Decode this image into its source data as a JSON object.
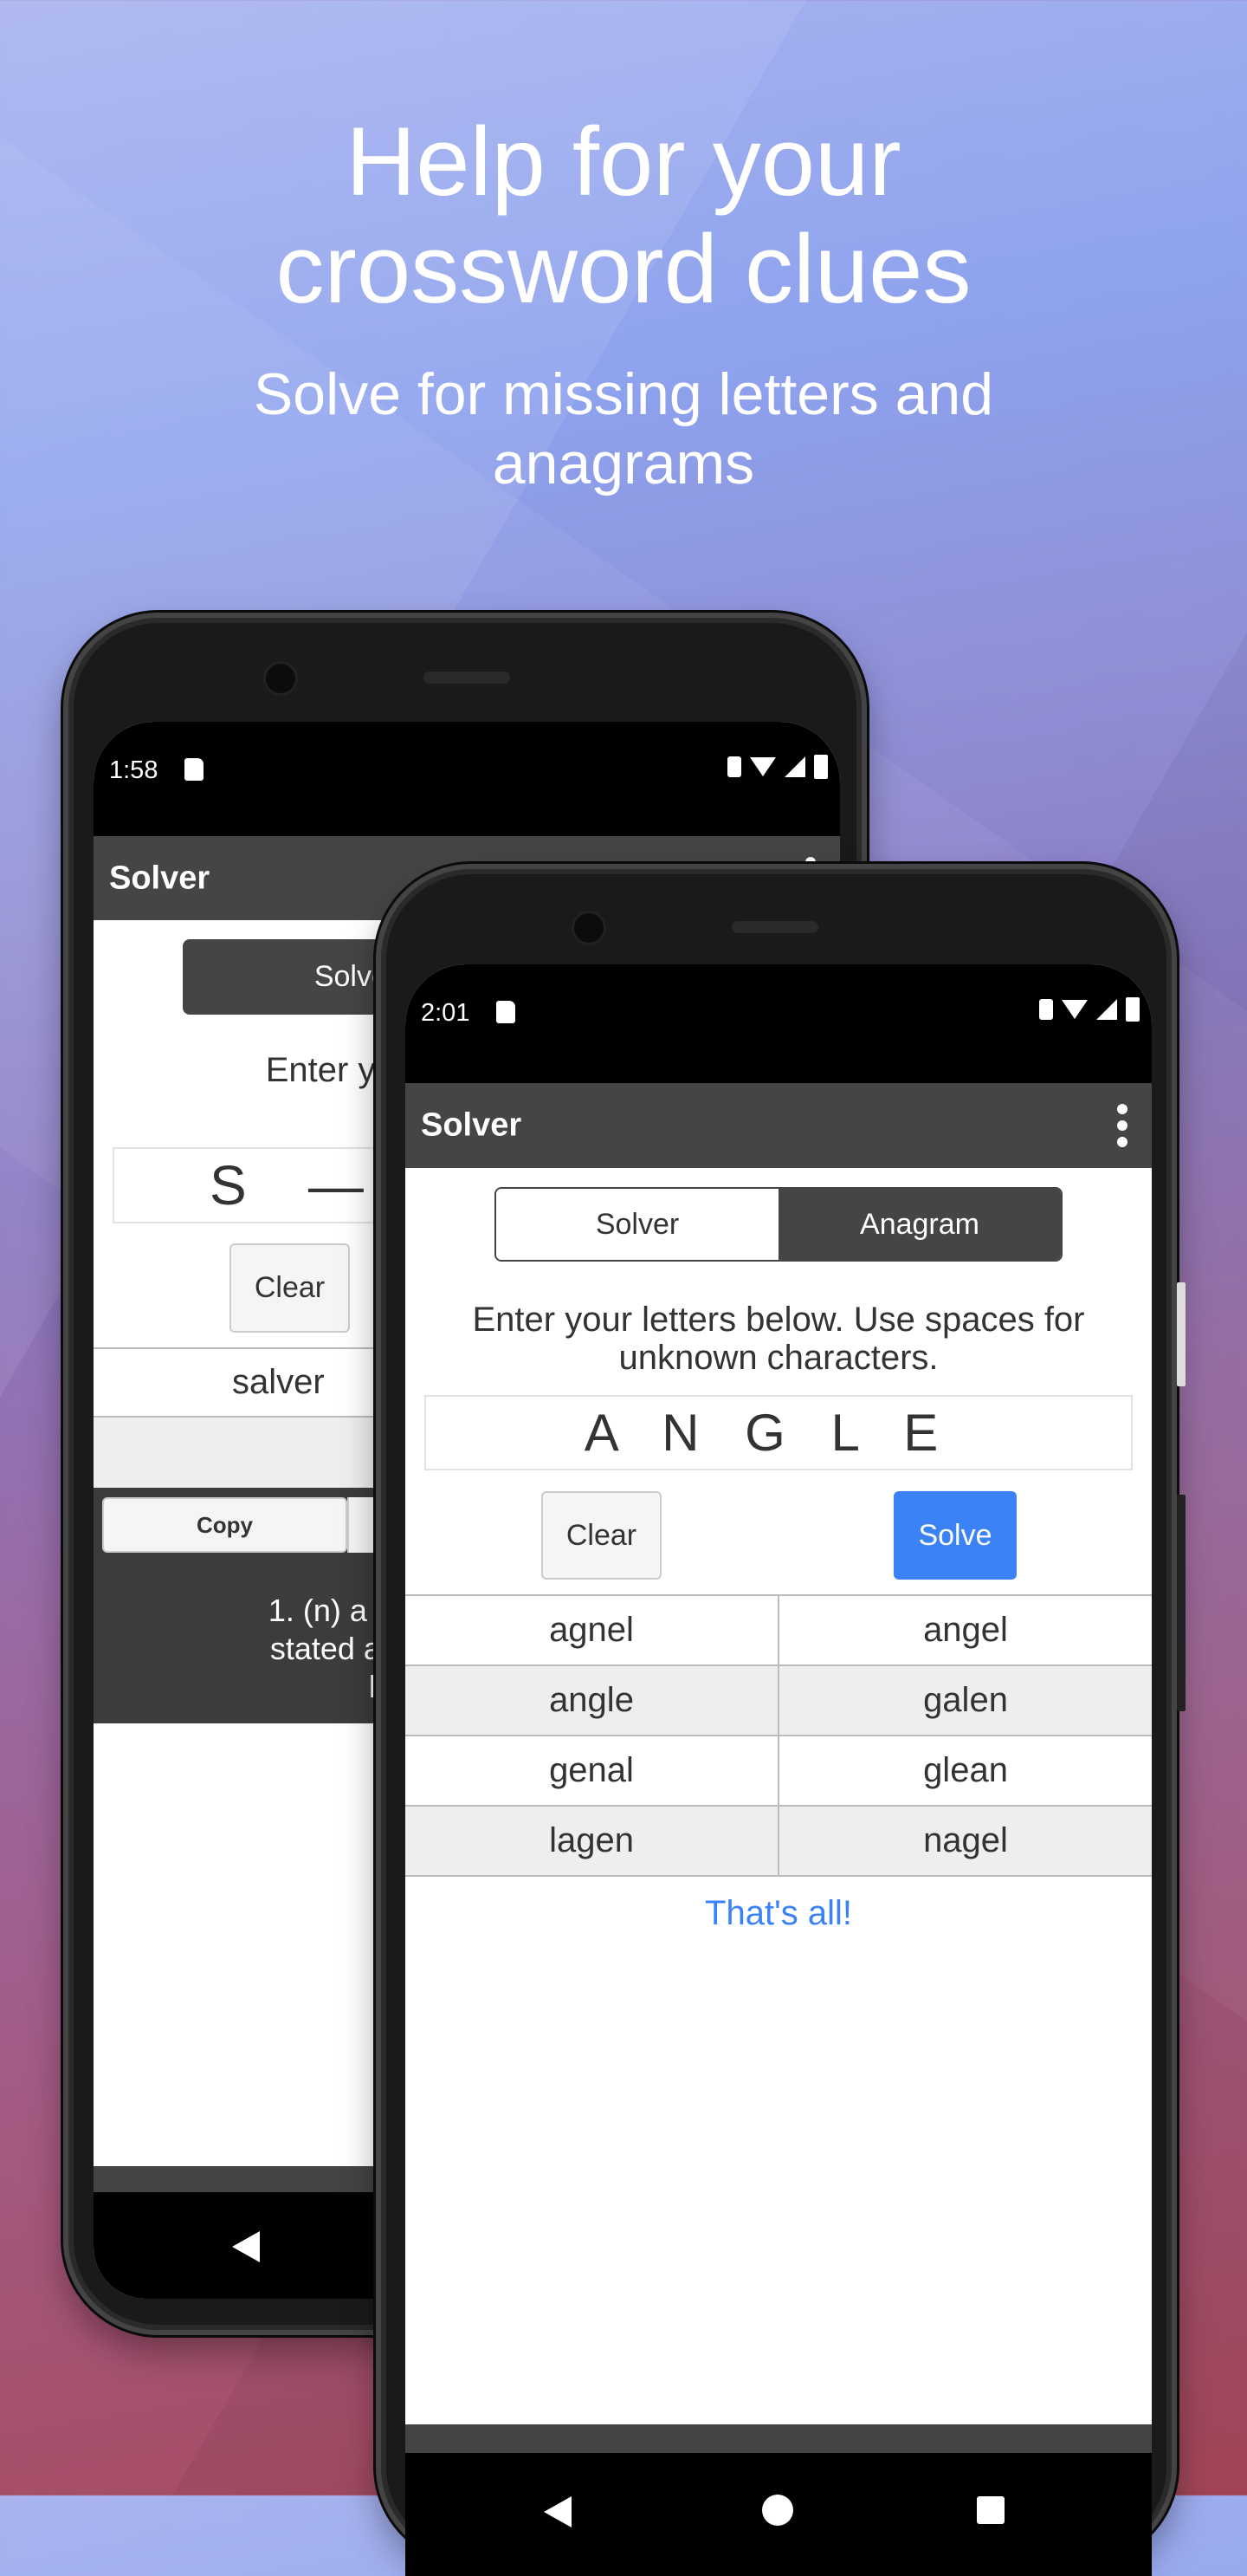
{
  "hero": {
    "title_line1": "Help for your",
    "title_line2": "crossword clues",
    "subtitle_line1": "Solve for missing letters and",
    "subtitle_line2": "anagrams"
  },
  "back_phone": {
    "time": "1:58",
    "app_title": "Solver",
    "toggle_active": "Solver",
    "instruction_line1": "Enter your lette",
    "instruction_line2": "unkn",
    "input_letters": "S    —",
    "clear_label": "Clear",
    "result": "salver",
    "copy_label": "Copy",
    "definition_line1": "1. (n) a thinker w",
    "definition_line2": "stated and tries t",
    "definition_line3": "knowledg"
  },
  "front_phone": {
    "time": "2:01",
    "app_title": "Solver",
    "tabs": [
      {
        "label": "Solver",
        "active": false
      },
      {
        "label": "Anagram",
        "active": true
      }
    ],
    "instruction_line1": "Enter your letters below. Use spaces for",
    "instruction_line2": "unknown characters.",
    "input_value": "A N G L E",
    "clear_label": "Clear",
    "solve_label": "Solve",
    "results": [
      [
        "agnel",
        "angel"
      ],
      [
        "angle",
        "galen"
      ],
      [
        "genal",
        "glean"
      ],
      [
        "lagen",
        "nagel"
      ]
    ],
    "footer": "That's all!"
  },
  "colors": {
    "accent": "#3b82f6",
    "appbar": "#454545",
    "footer_link": "#3b82f6"
  }
}
